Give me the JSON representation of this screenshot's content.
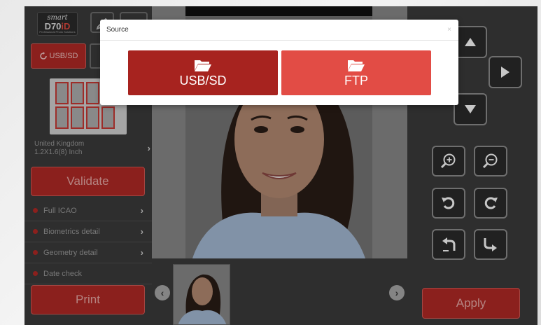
{
  "app": {
    "logo": {
      "top": "smart",
      "main_prefix": "D70",
      "main_accent": "iD",
      "sub": "Professional Photo Solutions"
    }
  },
  "left_panel": {
    "source_button_label": "USB/SD",
    "country": "United Kingdom",
    "format_size": "1.2X1.6(8) Inch",
    "validate_label": "Validate",
    "checks": [
      {
        "label": "Full ICAO",
        "has_chevron": true
      },
      {
        "label": "Biometrics detail",
        "has_chevron": true
      },
      {
        "label": "Geometry detail",
        "has_chevron": true
      },
      {
        "label": "Date check",
        "has_chevron": false
      }
    ],
    "print_label": "Print"
  },
  "right_panel": {
    "buttons": [
      {
        "icon": "arrow-up-icon"
      },
      {
        "icon": "arrow-right-icon"
      },
      {
        "icon": "arrow-down-icon"
      },
      {
        "icon": "zoom-in-icon"
      },
      {
        "icon": "zoom-out-icon"
      },
      {
        "icon": "rotate-left-icon"
      },
      {
        "icon": "rotate-right-icon"
      },
      {
        "icon": "tilt-left-icon"
      },
      {
        "icon": "tilt-right-icon"
      }
    ],
    "apply_label": "Apply"
  },
  "modal": {
    "title": "Source",
    "close": "×",
    "options": [
      {
        "label": "USB/SD",
        "icon": "folder-open-icon",
        "color": "#a7231f"
      },
      {
        "label": "FTP",
        "icon": "folder-open-icon",
        "color": "#e24c45"
      }
    ]
  },
  "colors": {
    "accent": "#b22a26",
    "panel": "#3b3b3b"
  }
}
